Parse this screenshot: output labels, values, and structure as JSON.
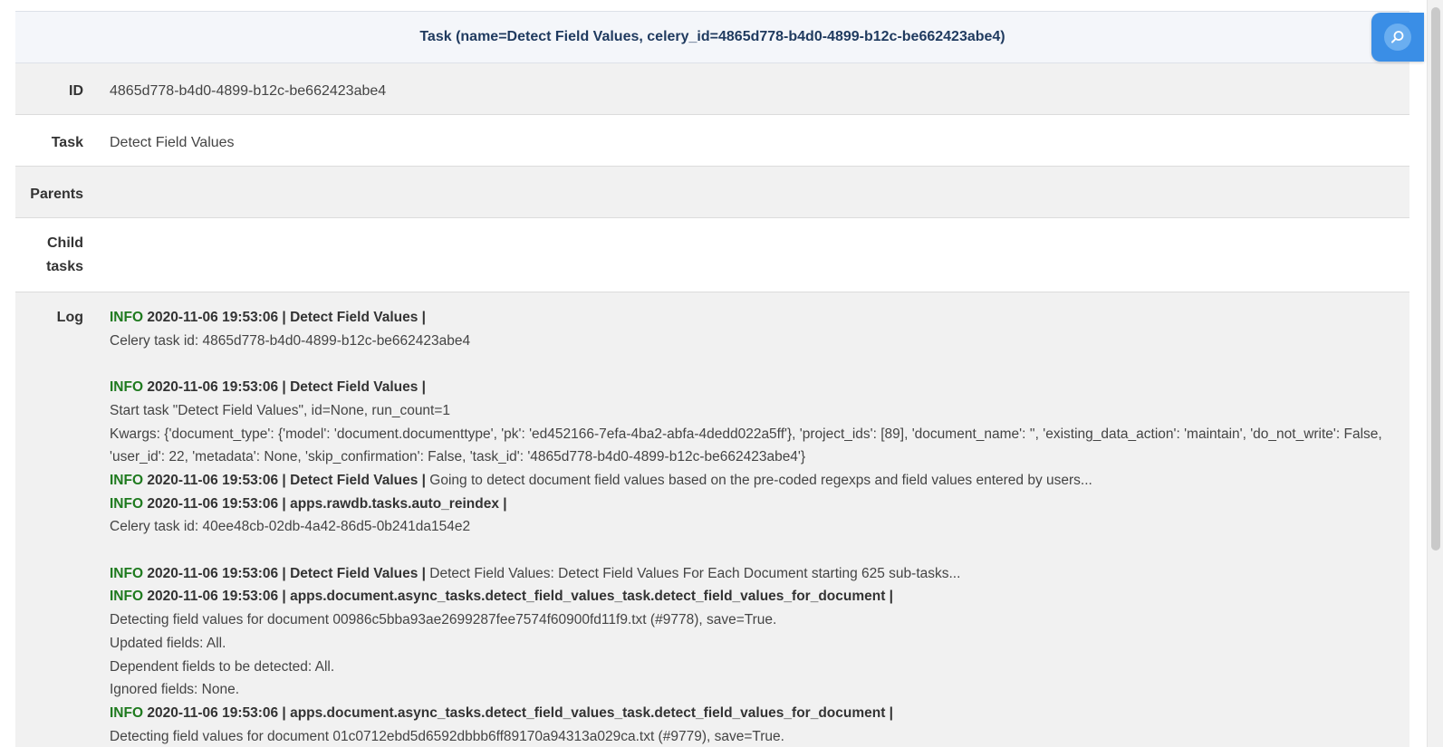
{
  "header": {
    "title": "Task (name=Detect Field Values, celery_id=4865d778-b4d0-4899-b12c-be662423abe4)"
  },
  "rows": {
    "id": {
      "label": "ID",
      "value": "4865d778-b4d0-4899-b12c-be662423abe4"
    },
    "task": {
      "label": "Task",
      "value": "Detect Field Values"
    },
    "parents": {
      "label": "Parents",
      "value": ""
    },
    "child_tasks": {
      "label_line1": "Child",
      "label_line2": "tasks",
      "value": ""
    },
    "log": {
      "label": "Log"
    }
  },
  "log": {
    "e1": {
      "level": "INFO",
      "head": "2020-11-06 19:53:06 | Detect Field Values |",
      "msg": "",
      "lines": [
        "Celery task id: 4865d778-b4d0-4899-b12c-be662423abe4"
      ]
    },
    "e2": {
      "level": "INFO",
      "head": "2020-11-06 19:53:06 | Detect Field Values |",
      "msg": "",
      "lines": [
        "Start task \"Detect Field Values\", id=None, run_count=1",
        "Kwargs: {'document_type': {'model': 'document.documenttype', 'pk': 'ed452166-7efa-4ba2-abfa-4dedd022a5ff'}, 'project_ids': [89], 'document_name': '', 'existing_data_action': 'maintain', 'do_not_write': False, 'user_id': 22, 'metadata': None, 'skip_confirmation': False, 'task_id': '4865d778-b4d0-4899-b12c-be662423abe4'}"
      ]
    },
    "e3": {
      "level": "INFO",
      "head": "2020-11-06 19:53:06 | Detect Field Values |",
      "msg": " Going to detect document field values based on the pre-coded regexps and field values entered by users..."
    },
    "e4": {
      "level": "INFO",
      "head": "2020-11-06 19:53:06 | apps.rawdb.tasks.auto_reindex |",
      "msg": "",
      "lines": [
        "Celery task id: 40ee48cb-02db-4a42-86d5-0b241da154e2"
      ]
    },
    "e5": {
      "level": "INFO",
      "head": "2020-11-06 19:53:06 | Detect Field Values |",
      "msg": " Detect Field Values: Detect Field Values For Each Document starting 625 sub-tasks..."
    },
    "e6": {
      "level": "INFO",
      "head": "2020-11-06 19:53:06 | apps.document.async_tasks.detect_field_values_task.detect_field_values_for_document |",
      "msg": "",
      "lines": [
        "Detecting field values for document 00986c5bba93ae2699287fee7574f60900fd11f9.txt (#9778), save=True.",
        "Updated fields: All.",
        "Dependent fields to be detected: All.",
        "Ignored fields: None."
      ]
    },
    "e7": {
      "level": "INFO",
      "head": "2020-11-06 19:53:06 | apps.document.async_tasks.detect_field_values_task.detect_field_values_for_document |",
      "msg": "",
      "lines": [
        "Detecting field values for document 01c0712ebd5d6592dbbb6ff89170a94313a029ca.txt (#9779), save=True."
      ]
    }
  },
  "search_button": {
    "icon": "search-icon",
    "color": "#3a8ee6"
  },
  "colors": {
    "info_level": "#1e7a1e",
    "header_text": "#1f3a5f"
  }
}
